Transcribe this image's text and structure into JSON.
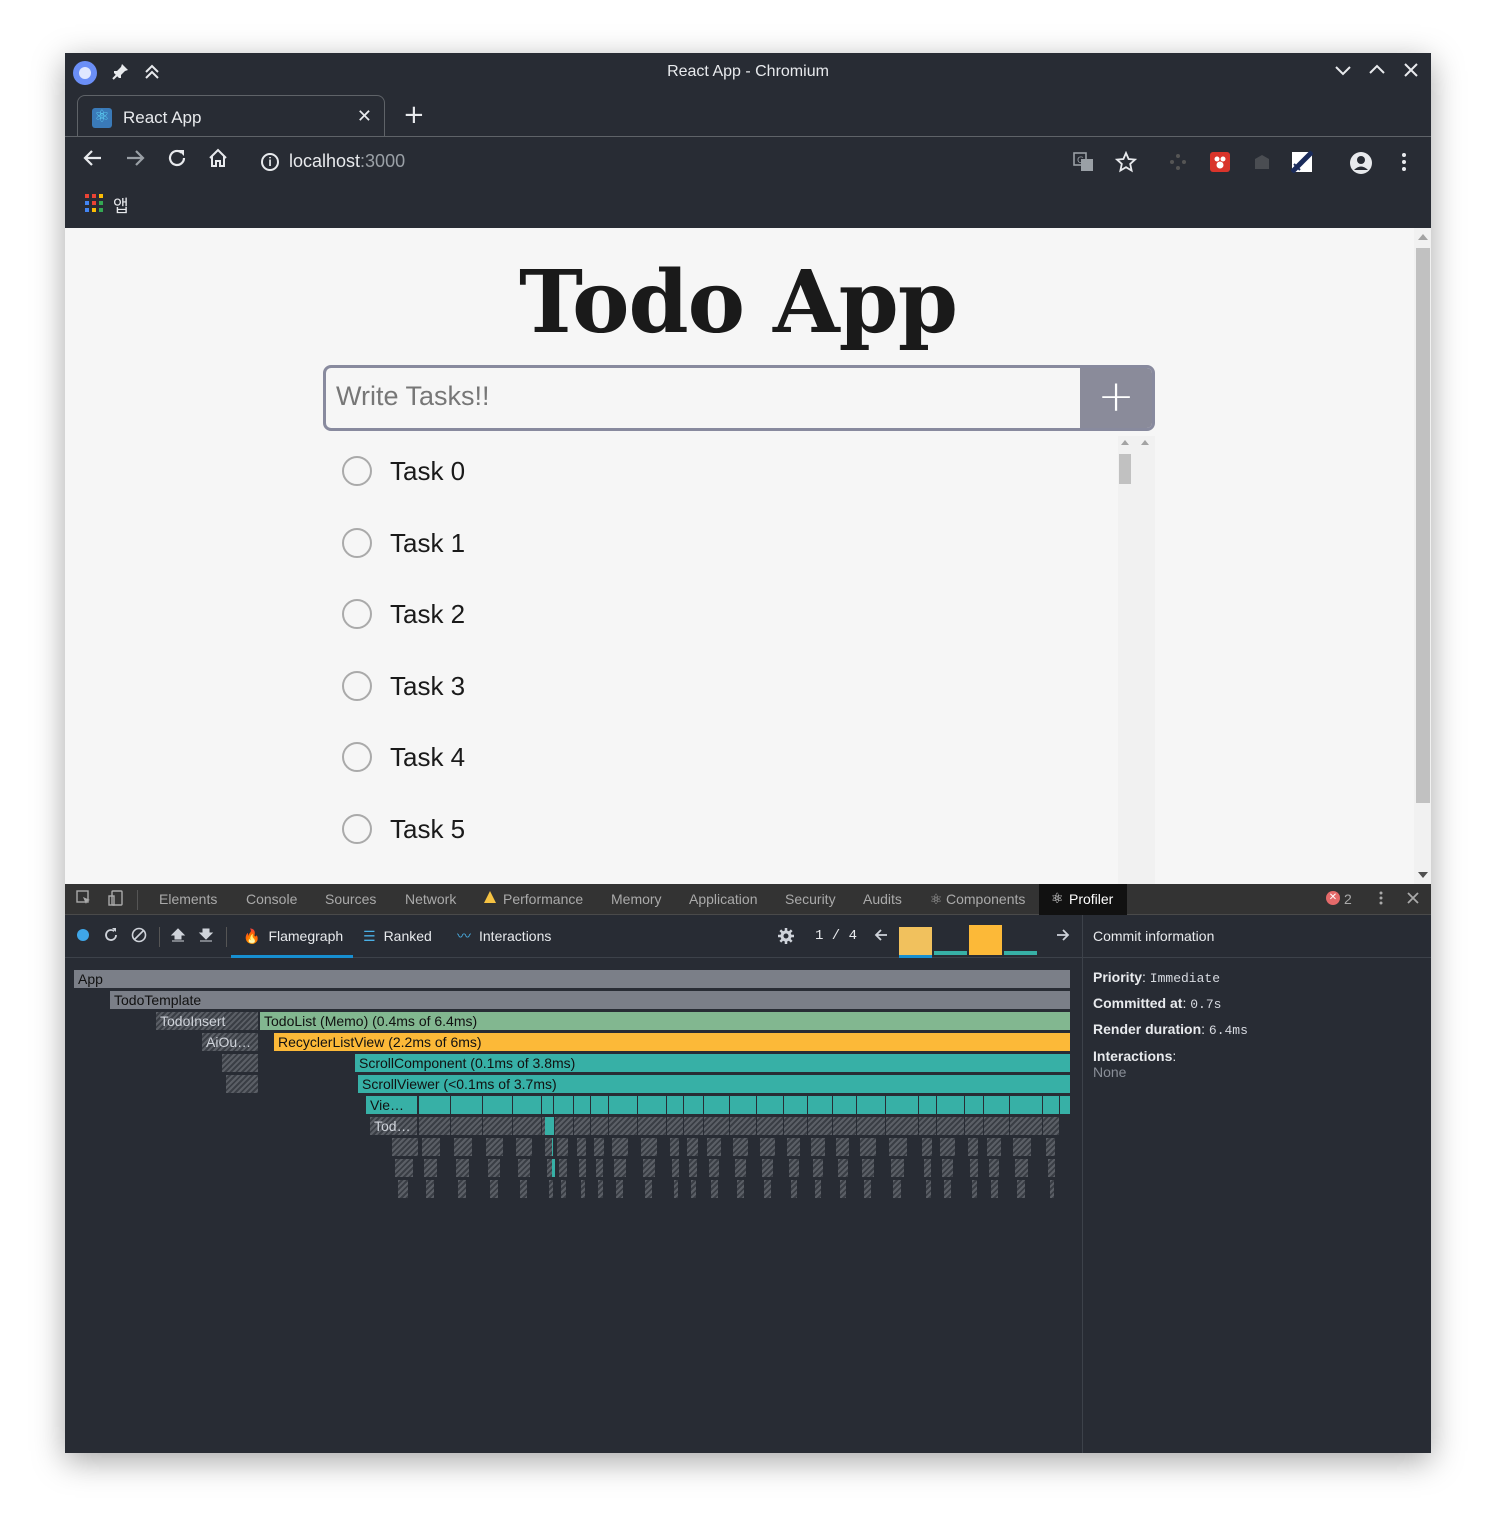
{
  "window": {
    "title": "React App - Chromium"
  },
  "tab": {
    "label": "React App",
    "close": "✕",
    "new_tab": "+"
  },
  "address": {
    "host": "localhost",
    "port": ":3000"
  },
  "bookmarks": {
    "apps_label": "앱"
  },
  "app": {
    "heading": "Todo App",
    "input_placeholder": "Write Tasks!!",
    "add_button": "+",
    "tasks": [
      "Task 0",
      "Task 1",
      "Task 2",
      "Task 3",
      "Task 4",
      "Task 5"
    ]
  },
  "devtools": {
    "tabs": [
      "Elements",
      "Console",
      "Sources",
      "Network",
      "Performance",
      "Memory",
      "Application",
      "Security",
      "Audits",
      "Components",
      "Profiler"
    ],
    "active_tab": "Profiler",
    "error_count": "2",
    "profiler": {
      "views": [
        "Flamegraph",
        "Ranked",
        "Interactions"
      ],
      "active_view": "Flamegraph",
      "commit_nav": "1 / 4",
      "flame_labels": {
        "app": "App",
        "todo_template": "TodoTemplate",
        "todo_insert": "TodoInsert",
        "todo_list": "TodoList (Memo) (0.4ms of 6.4ms)",
        "ai_outline": "AiOu…",
        "recycler": "RecyclerListView (2.2ms of 6ms)",
        "scroll_component": "ScrollComponent (0.1ms of 3.8ms)",
        "scroll_viewer": "ScrollViewer (<0.1ms of 3.7ms)",
        "view": "Vie…",
        "tod": "Tod…"
      }
    },
    "commit_info": {
      "header": "Commit information",
      "priority_label": "Priority",
      "priority": "Immediate",
      "committed_label": "Committed at",
      "committed": "0.7s",
      "render_label": "Render duration",
      "render": "6.4ms",
      "interactions_label": "Interactions",
      "interactions": "None"
    }
  },
  "colors": {
    "flame_gray": "#7b7f88",
    "flame_green": "#82b790",
    "flame_yellow": "#fcb938",
    "flame_teal": "#37b0a6",
    "accent_blue": "#178fd1"
  }
}
